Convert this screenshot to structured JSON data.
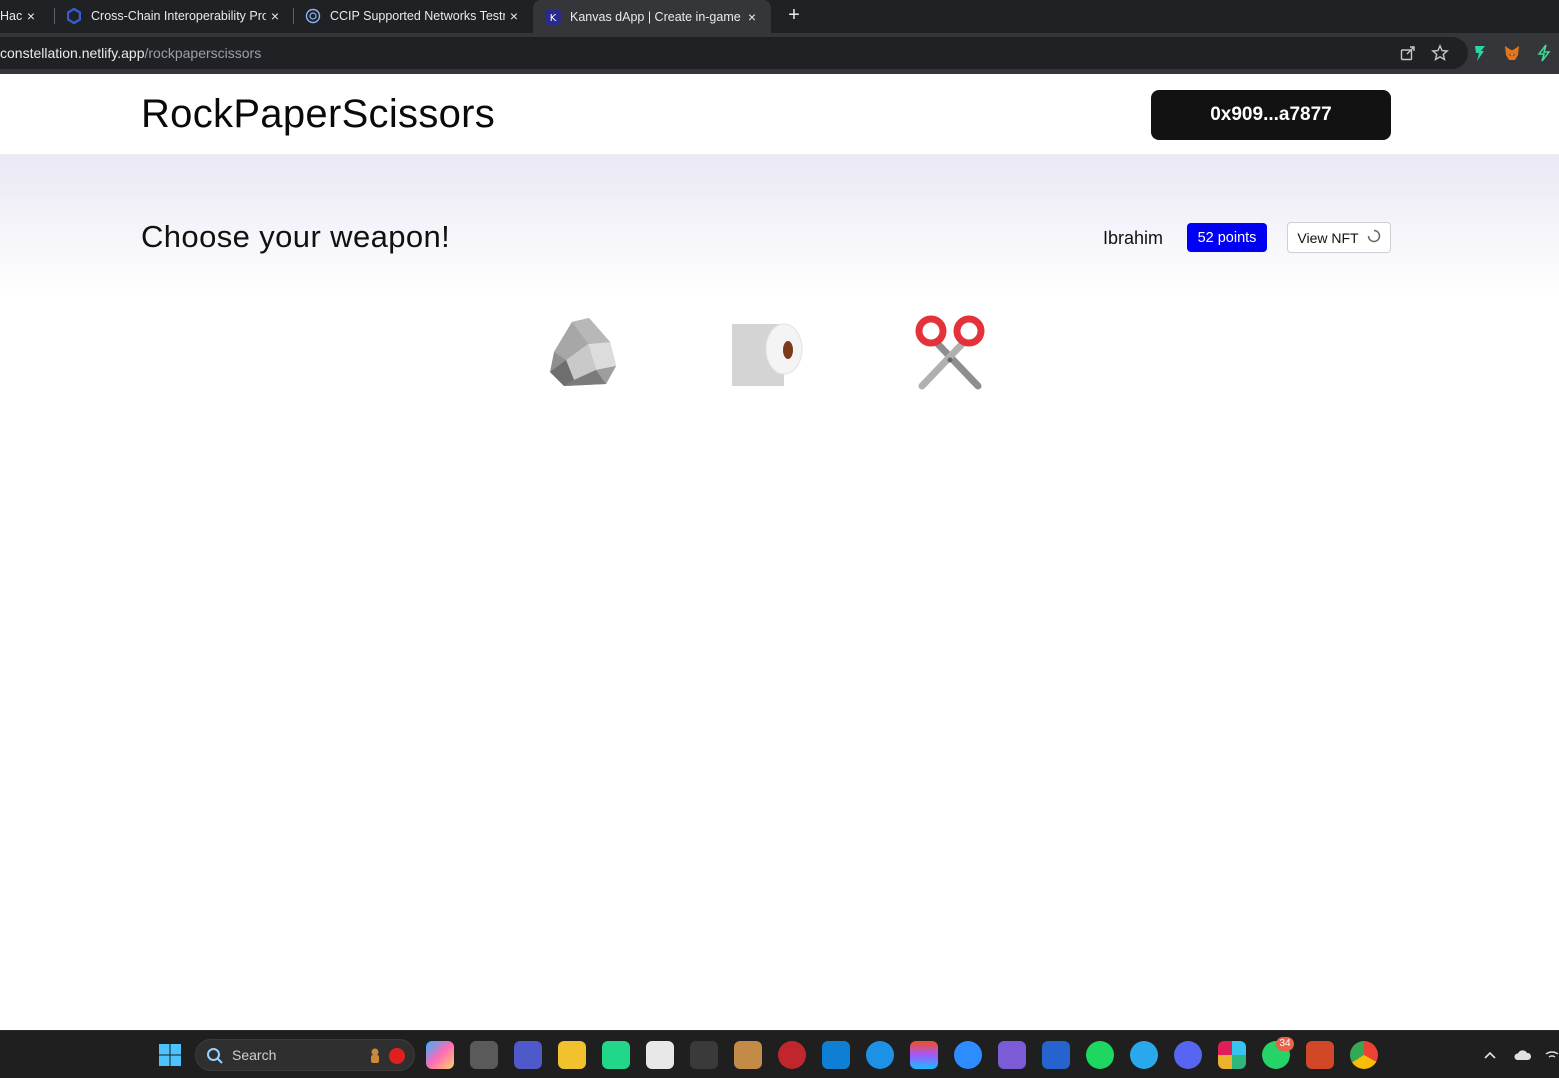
{
  "browser": {
    "tabs": [
      {
        "title": "Hacka",
        "active": false
      },
      {
        "title": "Cross-Chain Interoperability Pro",
        "active": false
      },
      {
        "title": "CCIP Supported Networks Testne",
        "active": false
      },
      {
        "title": "Kanvas dApp | Create in-game D",
        "active": true
      }
    ],
    "new_tab_label": "+",
    "close_glyph": "×",
    "address": {
      "host": "constellation.netlify.app",
      "path": "/rockpaperscissors"
    }
  },
  "header": {
    "brand": "RockPaperScissors",
    "wallet_address": "0x909...a7877"
  },
  "game": {
    "headline": "Choose your weapon!",
    "player_name": "Ibrahim",
    "points": "52 points",
    "view_nft_label": "View NFT",
    "weapons": [
      {
        "name": "rock",
        "icon": "rock-icon"
      },
      {
        "name": "paper",
        "icon": "toilet-paper-icon"
      },
      {
        "name": "scissors",
        "icon": "scissors-icon"
      }
    ]
  },
  "taskbar": {
    "search_label": "Search",
    "whatsapp_badge": "34"
  },
  "colors": {
    "points_badge": "#0000f5",
    "wallet_button": "#121212",
    "band_top": "#e9e8f4"
  }
}
